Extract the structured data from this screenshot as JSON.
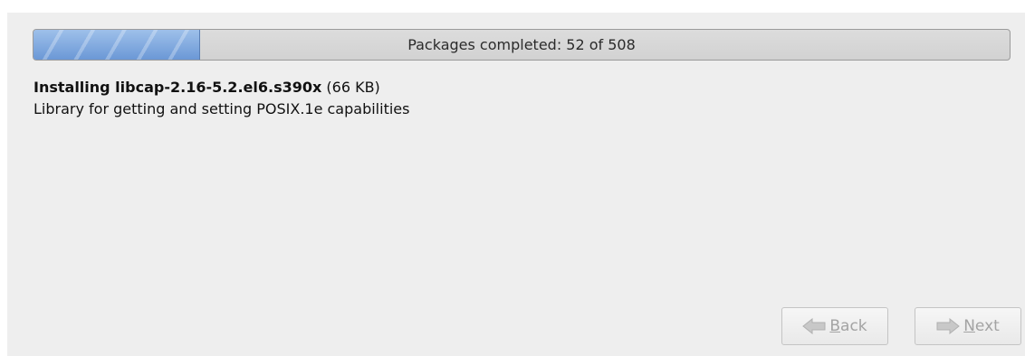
{
  "progress": {
    "label": "Packages completed: 52 of 508",
    "completed": 52,
    "total": 508,
    "fraction": 0.17
  },
  "package": {
    "action_and_name": "Installing libcap-2.16-5.2.el6.s390x",
    "size": " (66 KB)",
    "description": "Library for getting and setting POSIX.1e capabilities"
  },
  "buttons": {
    "back": {
      "mnemonic": "B",
      "rest": "ack",
      "icon": "arrow-left-icon",
      "enabled": false
    },
    "next": {
      "mnemonic": "N",
      "rest": "ext",
      "icon": "arrow-right-icon",
      "enabled": false
    }
  },
  "colors": {
    "panel_bg": "#eeeeee",
    "progress_fill": "#7fa7dd",
    "disabled_text": "#a3a3a3"
  }
}
